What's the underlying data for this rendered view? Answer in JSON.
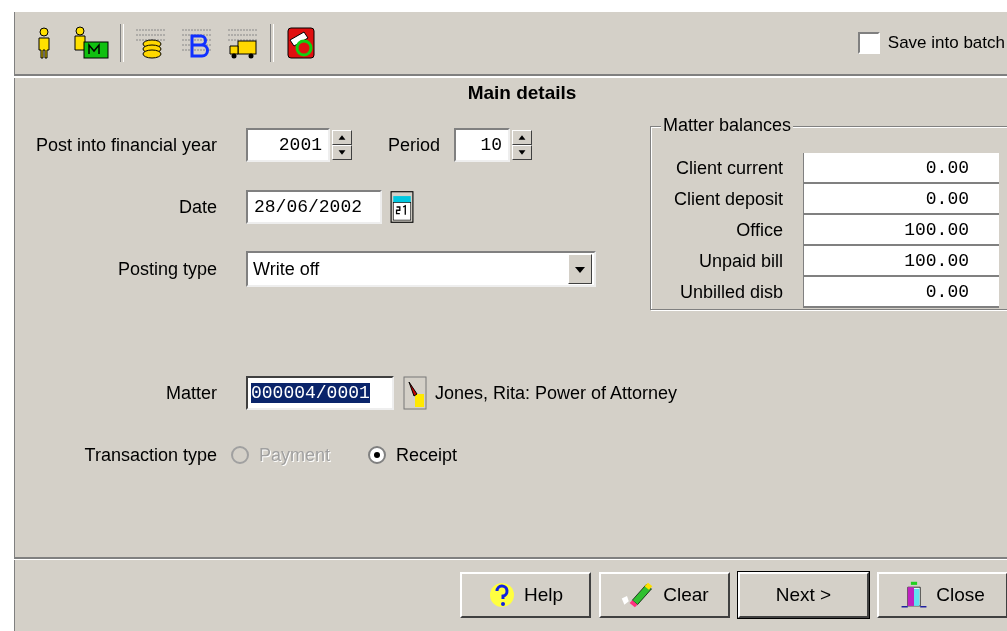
{
  "save_into_batch": {
    "label": "Save into batch",
    "checked": false
  },
  "section_title": "Main details",
  "financial_year": {
    "label": "Post into financial year",
    "value": "2001"
  },
  "period": {
    "label": "Period",
    "value": "10"
  },
  "date": {
    "label": "Date",
    "value": "28/06/2002"
  },
  "posting_type": {
    "label": "Posting type",
    "value": "Write off"
  },
  "matter": {
    "label": "Matter",
    "value": "000004/0001",
    "text_selected": true,
    "description": "Jones, Rita: Power of Attorney"
  },
  "transaction_type": {
    "label": "Transaction type",
    "options": [
      {
        "label": "Payment",
        "selected": false,
        "disabled": true
      },
      {
        "label": "Receipt",
        "selected": true,
        "disabled": false
      }
    ]
  },
  "matter_balances": {
    "title": "Matter balances",
    "rows": [
      {
        "label": "Client current",
        "value": "0.00"
      },
      {
        "label": "Client deposit",
        "value": "0.00"
      },
      {
        "label": "Office",
        "value": "100.00"
      },
      {
        "label": "Unpaid bill",
        "value": "100.00"
      },
      {
        "label": "Unbilled disb",
        "value": "0.00"
      }
    ]
  },
  "buttons": [
    {
      "kind": "help",
      "label": "Help",
      "default": false
    },
    {
      "kind": "clear",
      "label": "Clear",
      "default": false
    },
    {
      "kind": "next",
      "label": "Next >",
      "default": true
    },
    {
      "kind": "close",
      "label": "Close",
      "default": false
    }
  ]
}
